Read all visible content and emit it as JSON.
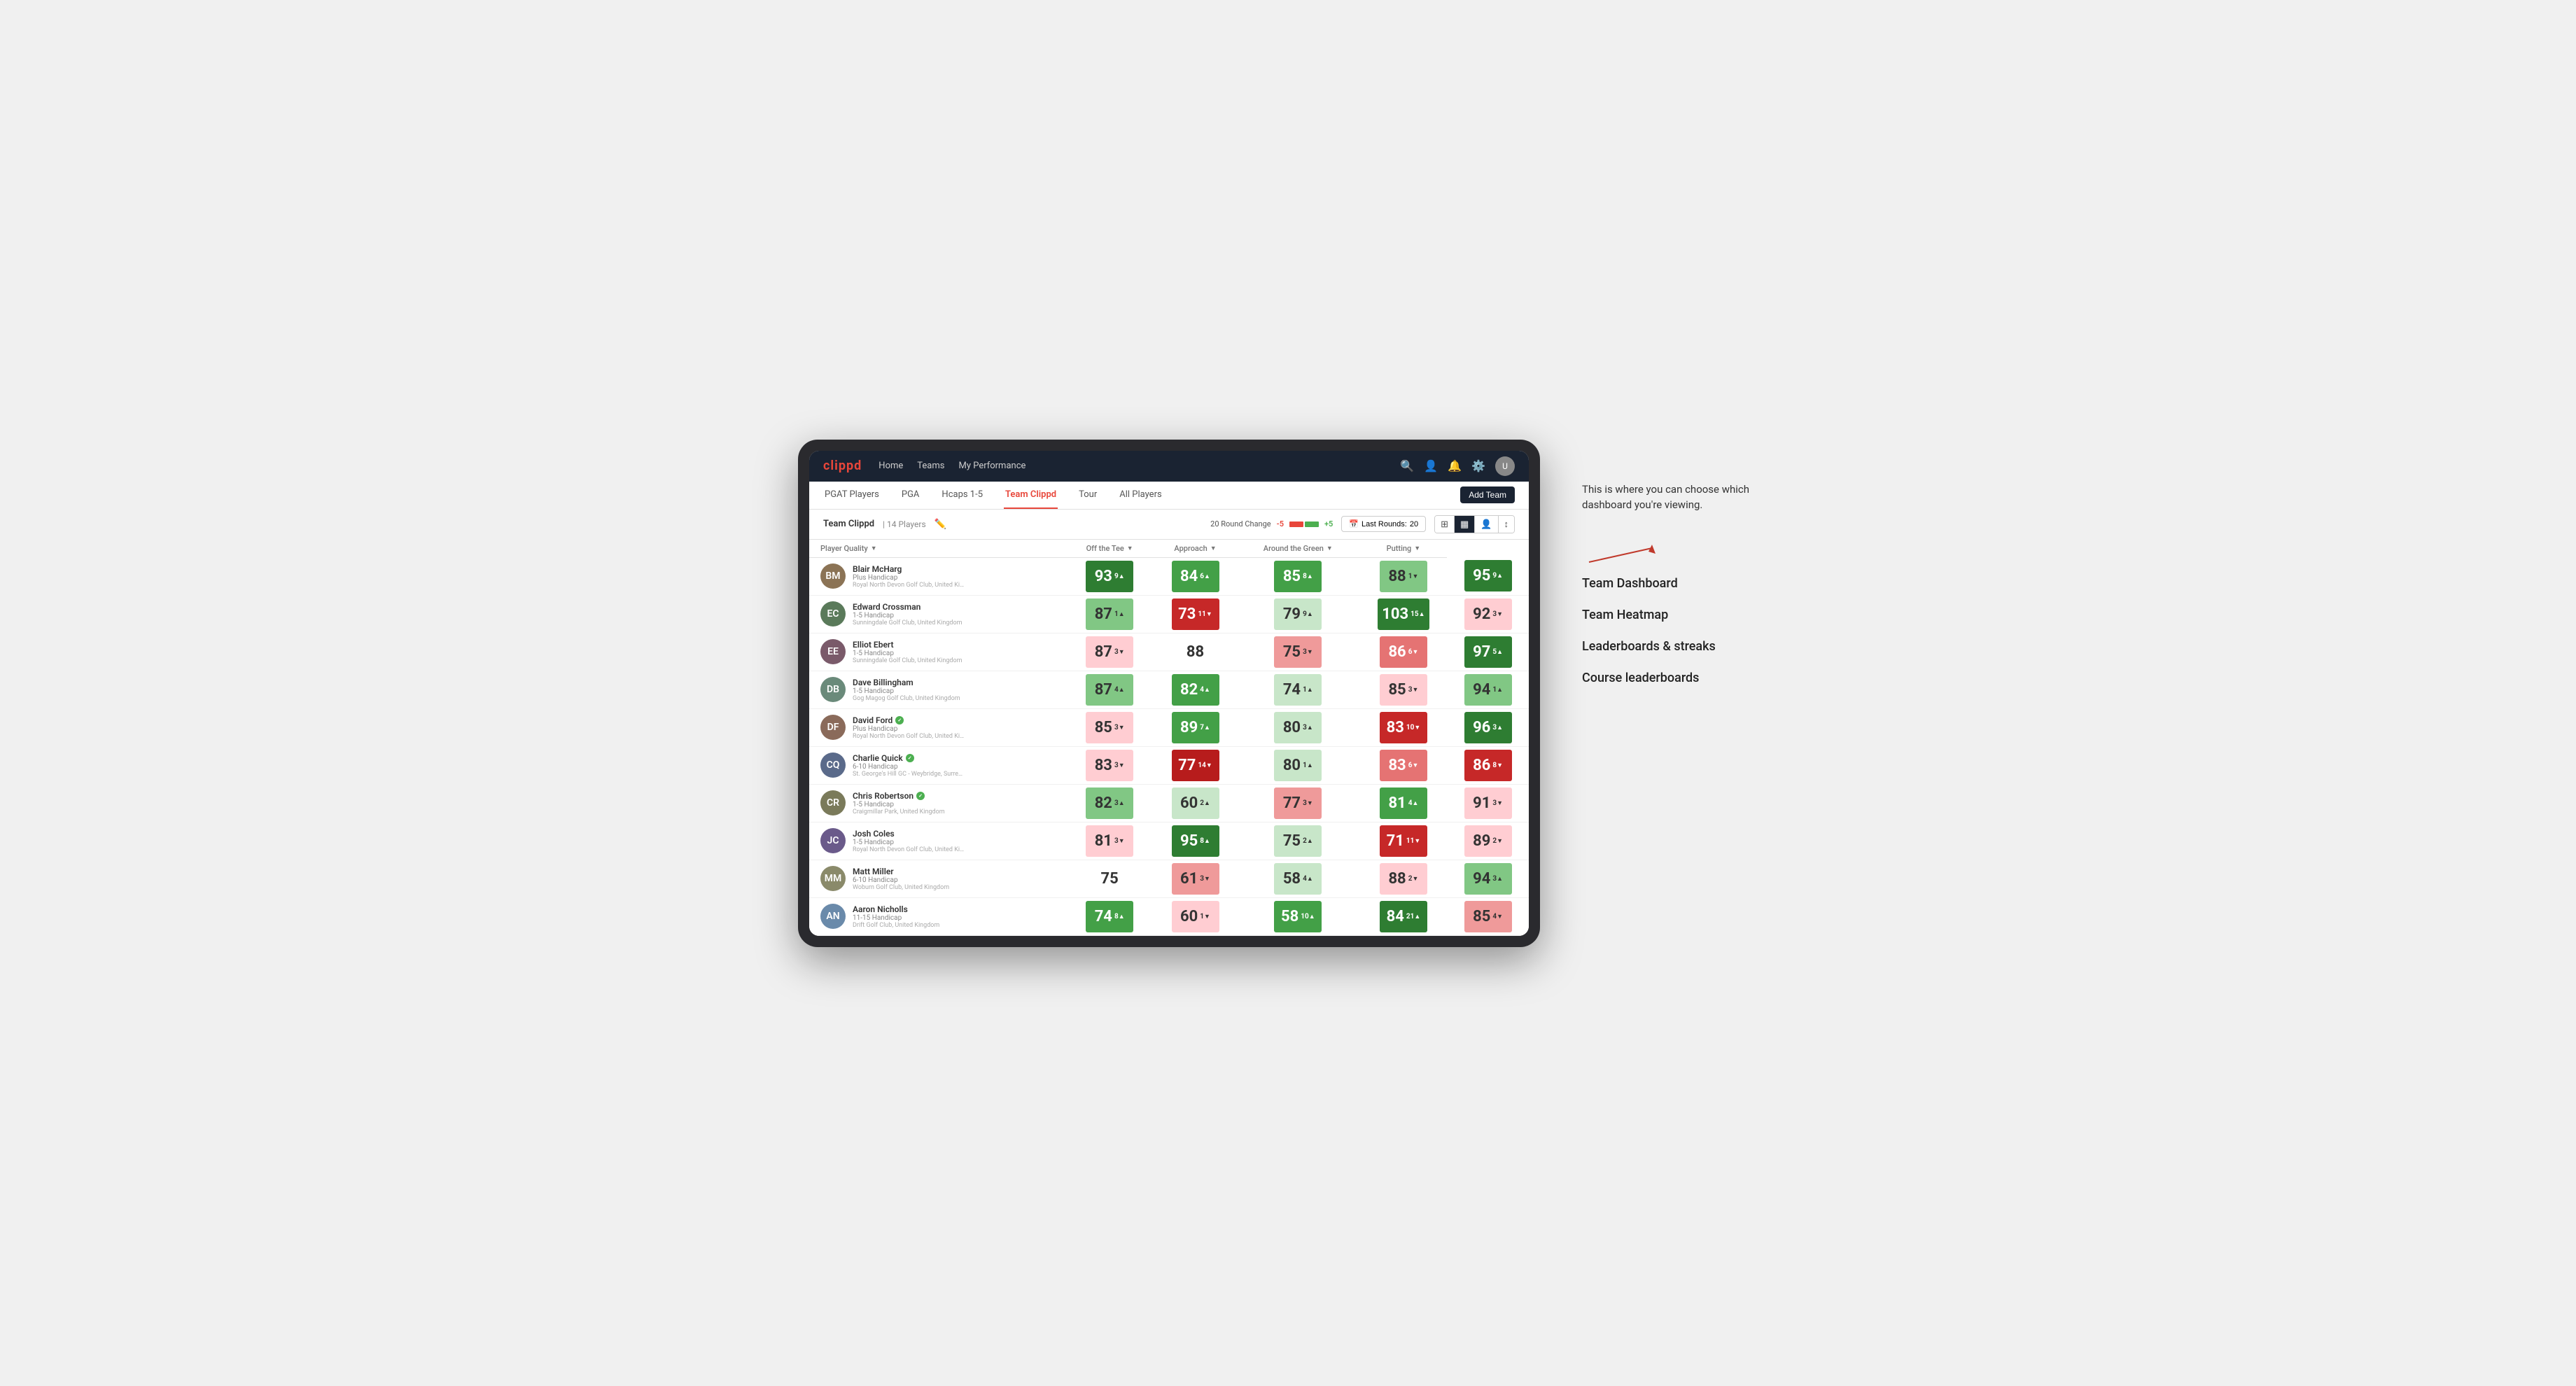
{
  "brand": {
    "name": "clippd"
  },
  "topNav": {
    "links": [
      "Home",
      "Teams",
      "My Performance"
    ],
    "icons": [
      "search",
      "user",
      "bell",
      "settings",
      "avatar"
    ]
  },
  "secondaryNav": {
    "links": [
      "PGAT Players",
      "PGA",
      "Hcaps 1-5",
      "Team Clippd",
      "Tour",
      "All Players"
    ],
    "activeIndex": 3,
    "addTeamLabel": "Add Team"
  },
  "teamHeader": {
    "teamName": "Team Clippd",
    "separator": "|",
    "playerCount": "14 Players",
    "roundChangeLabel": "20 Round Change",
    "minus": "-5",
    "plus": "+5",
    "lastRoundsLabel": "Last Rounds:",
    "lastRoundsValue": "20"
  },
  "tableHeaders": {
    "playerQuality": "Player Quality",
    "offTee": "Off the Tee",
    "approach": "Approach",
    "aroundGreen": "Around the Green",
    "putting": "Putting"
  },
  "players": [
    {
      "name": "Blair McHarg",
      "handicap": "Plus Handicap",
      "club": "Royal North Devon Golf Club, United Kingdom",
      "avatarColor": "#8B7355",
      "initials": "BM",
      "playerQuality": {
        "value": "93",
        "change": "9",
        "dir": "up",
        "bg": "bg-dark-green"
      },
      "offTee": {
        "value": "84",
        "change": "6",
        "dir": "up",
        "bg": "bg-med-green"
      },
      "approach": {
        "value": "85",
        "change": "8",
        "dir": "up",
        "bg": "bg-med-green"
      },
      "aroundGreen": {
        "value": "88",
        "change": "1",
        "dir": "down",
        "bg": "bg-light-green"
      },
      "putting": {
        "value": "95",
        "change": "9",
        "dir": "up",
        "bg": "bg-dark-green"
      }
    },
    {
      "name": "Edward Crossman",
      "handicap": "1-5 Handicap",
      "club": "Sunningdale Golf Club, United Kingdom",
      "avatarColor": "#5a7a5a",
      "initials": "EC",
      "playerQuality": {
        "value": "87",
        "change": "1",
        "dir": "up",
        "bg": "bg-light-green"
      },
      "offTee": {
        "value": "73",
        "change": "11",
        "dir": "down",
        "bg": "bg-dark-red"
      },
      "approach": {
        "value": "79",
        "change": "9",
        "dir": "up",
        "bg": "bg-pale-green"
      },
      "aroundGreen": {
        "value": "103",
        "change": "15",
        "dir": "up",
        "bg": "bg-dark-green"
      },
      "putting": {
        "value": "92",
        "change": "3",
        "dir": "down",
        "bg": "bg-pale-red"
      }
    },
    {
      "name": "Elliot Ebert",
      "handicap": "1-5 Handicap",
      "club": "Sunningdale Golf Club, United Kingdom",
      "avatarColor": "#7a5a6a",
      "initials": "EE",
      "playerQuality": {
        "value": "87",
        "change": "3",
        "dir": "down",
        "bg": "bg-pale-red"
      },
      "offTee": {
        "value": "88",
        "change": "",
        "dir": "",
        "bg": "bg-white"
      },
      "approach": {
        "value": "75",
        "change": "3",
        "dir": "down",
        "bg": "bg-light-red"
      },
      "aroundGreen": {
        "value": "86",
        "change": "6",
        "dir": "down",
        "bg": "bg-med-red"
      },
      "putting": {
        "value": "97",
        "change": "5",
        "dir": "up",
        "bg": "bg-dark-green"
      }
    },
    {
      "name": "Dave Billingham",
      "handicap": "1-5 Handicap",
      "club": "Gog Magog Golf Club, United Kingdom",
      "avatarColor": "#6a8a7a",
      "initials": "DB",
      "playerQuality": {
        "value": "87",
        "change": "4",
        "dir": "up",
        "bg": "bg-light-green"
      },
      "offTee": {
        "value": "82",
        "change": "4",
        "dir": "up",
        "bg": "bg-med-green"
      },
      "approach": {
        "value": "74",
        "change": "1",
        "dir": "up",
        "bg": "bg-pale-green"
      },
      "aroundGreen": {
        "value": "85",
        "change": "3",
        "dir": "down",
        "bg": "bg-pale-red"
      },
      "putting": {
        "value": "94",
        "change": "1",
        "dir": "up",
        "bg": "bg-light-green"
      }
    },
    {
      "name": "David Ford",
      "handicap": "Plus Handicap",
      "club": "Royal North Devon Golf Club, United Kingdom",
      "avatarColor": "#8a6a5a",
      "initials": "DF",
      "verified": true,
      "playerQuality": {
        "value": "85",
        "change": "3",
        "dir": "down",
        "bg": "bg-pale-red"
      },
      "offTee": {
        "value": "89",
        "change": "7",
        "dir": "up",
        "bg": "bg-med-green"
      },
      "approach": {
        "value": "80",
        "change": "3",
        "dir": "up",
        "bg": "bg-pale-green"
      },
      "aroundGreen": {
        "value": "83",
        "change": "10",
        "dir": "down",
        "bg": "bg-dark-red"
      },
      "putting": {
        "value": "96",
        "change": "3",
        "dir": "up",
        "bg": "bg-dark-green"
      }
    },
    {
      "name": "Charlie Quick",
      "handicap": "6-10 Handicap",
      "club": "St. George's Hill GC - Weybridge, Surrey, Uni...",
      "avatarColor": "#5a6a8a",
      "initials": "CQ",
      "verified": true,
      "playerQuality": {
        "value": "83",
        "change": "3",
        "dir": "down",
        "bg": "bg-pale-red"
      },
      "offTee": {
        "value": "77",
        "change": "14",
        "dir": "down",
        "bg": "bg-deepest-red"
      },
      "approach": {
        "value": "80",
        "change": "1",
        "dir": "up",
        "bg": "bg-pale-green"
      },
      "aroundGreen": {
        "value": "83",
        "change": "6",
        "dir": "down",
        "bg": "bg-med-red"
      },
      "putting": {
        "value": "86",
        "change": "8",
        "dir": "down",
        "bg": "bg-dark-red"
      }
    },
    {
      "name": "Chris Robertson",
      "handicap": "1-5 Handicap",
      "club": "Craigmillar Park, United Kingdom",
      "avatarColor": "#7a7a5a",
      "initials": "CR",
      "verified": true,
      "playerQuality": {
        "value": "82",
        "change": "3",
        "dir": "up",
        "bg": "bg-light-green"
      },
      "offTee": {
        "value": "60",
        "change": "2",
        "dir": "up",
        "bg": "bg-pale-green"
      },
      "approach": {
        "value": "77",
        "change": "3",
        "dir": "down",
        "bg": "bg-light-red"
      },
      "aroundGreen": {
        "value": "81",
        "change": "4",
        "dir": "up",
        "bg": "bg-med-green"
      },
      "putting": {
        "value": "91",
        "change": "3",
        "dir": "down",
        "bg": "bg-pale-red"
      }
    },
    {
      "name": "Josh Coles",
      "handicap": "1-5 Handicap",
      "club": "Royal North Devon Golf Club, United Kingdom",
      "avatarColor": "#6a5a8a",
      "initials": "JC",
      "playerQuality": {
        "value": "81",
        "change": "3",
        "dir": "down",
        "bg": "bg-pale-red"
      },
      "offTee": {
        "value": "95",
        "change": "8",
        "dir": "up",
        "bg": "bg-dark-green"
      },
      "approach": {
        "value": "75",
        "change": "2",
        "dir": "up",
        "bg": "bg-pale-green"
      },
      "aroundGreen": {
        "value": "71",
        "change": "11",
        "dir": "down",
        "bg": "bg-dark-red"
      },
      "putting": {
        "value": "89",
        "change": "2",
        "dir": "down",
        "bg": "bg-pale-red"
      }
    },
    {
      "name": "Matt Miller",
      "handicap": "6-10 Handicap",
      "club": "Woburn Golf Club, United Kingdom",
      "avatarColor": "#8a8a6a",
      "initials": "MM",
      "playerQuality": {
        "value": "75",
        "change": "",
        "dir": "",
        "bg": "bg-white"
      },
      "offTee": {
        "value": "61",
        "change": "3",
        "dir": "down",
        "bg": "bg-light-red"
      },
      "approach": {
        "value": "58",
        "change": "4",
        "dir": "up",
        "bg": "bg-pale-green"
      },
      "aroundGreen": {
        "value": "88",
        "change": "2",
        "dir": "down",
        "bg": "bg-pale-red"
      },
      "putting": {
        "value": "94",
        "change": "3",
        "dir": "up",
        "bg": "bg-light-green"
      }
    },
    {
      "name": "Aaron Nicholls",
      "handicap": "11-15 Handicap",
      "club": "Drift Golf Club, United Kingdom",
      "avatarColor": "#6a8aaa",
      "initials": "AN",
      "playerQuality": {
        "value": "74",
        "change": "8",
        "dir": "up",
        "bg": "bg-med-green"
      },
      "offTee": {
        "value": "60",
        "change": "1",
        "dir": "down",
        "bg": "bg-pale-red"
      },
      "approach": {
        "value": "58",
        "change": "10",
        "dir": "up",
        "bg": "bg-med-green"
      },
      "aroundGreen": {
        "value": "84",
        "change": "21",
        "dir": "up",
        "bg": "bg-dark-green"
      },
      "putting": {
        "value": "85",
        "change": "4",
        "dir": "down",
        "bg": "bg-light-red"
      }
    }
  ],
  "annotation": {
    "intro": "This is where you can choose which dashboard you're viewing.",
    "options": [
      "Team Dashboard",
      "Team Heatmap",
      "Leaderboards & streaks",
      "Course leaderboards"
    ]
  }
}
